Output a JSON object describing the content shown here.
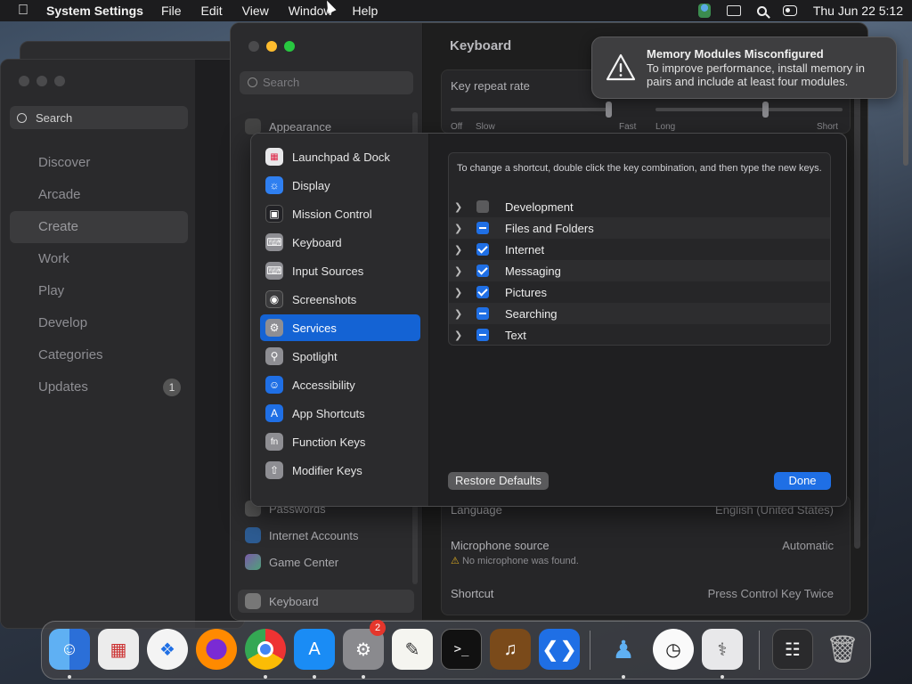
{
  "menubar": {
    "app_name": "System Settings",
    "items": [
      "File",
      "Edit",
      "View",
      "Window",
      "Help"
    ],
    "clock": "Thu Jun 22  5:12"
  },
  "appstore": {
    "search_placeholder": "Search",
    "nav": [
      {
        "label": "Discover"
      },
      {
        "label": "Arcade"
      },
      {
        "label": "Create",
        "active": true
      },
      {
        "label": "Work"
      },
      {
        "label": "Play"
      },
      {
        "label": "Develop"
      },
      {
        "label": "Categories"
      },
      {
        "label": "Updates",
        "badge": "1"
      }
    ]
  },
  "settings": {
    "search_placeholder": "Search",
    "title": "Keyboard",
    "sidebar": [
      "Appearance",
      "Passwords",
      "Internet Accounts",
      "Game Center",
      "Keyboard"
    ],
    "key_repeat_label": "Key repeat rate",
    "slider1_labels": [
      "Off",
      "Slow",
      "Fast"
    ],
    "slider2_labels": [
      "Long",
      "Short"
    ],
    "language_label": "Language",
    "language_value": "English (United States)",
    "mic_label": "Microphone source",
    "mic_value": "Automatic",
    "mic_warning": "No microphone was found.",
    "shortcut_label": "Shortcut",
    "shortcut_value": "Press Control Key Twice"
  },
  "notification": {
    "title": "Memory Modules Misconfigured",
    "body": "To improve performance, install memory in pairs and include at least four modules."
  },
  "sheet": {
    "categories": [
      {
        "label": "Launchpad & Dock",
        "icon": "launchpad-icon",
        "color": "#e8e8ea"
      },
      {
        "label": "Display",
        "icon": "display-icon",
        "color": "#2f7ff0"
      },
      {
        "label": "Mission Control",
        "icon": "mission-control-icon",
        "color": "#222226"
      },
      {
        "label": "Keyboard",
        "icon": "keyboard-icon",
        "color": "#8e8e93"
      },
      {
        "label": "Input Sources",
        "icon": "input-sources-icon",
        "color": "#8e8e93"
      },
      {
        "label": "Screenshots",
        "icon": "screenshots-icon",
        "color": "#3a3a3c"
      },
      {
        "label": "Services",
        "icon": "services-icon",
        "color": "#8e8e93",
        "selected": true
      },
      {
        "label": "Spotlight",
        "icon": "spotlight-icon",
        "color": "#8e8e93"
      },
      {
        "label": "Accessibility",
        "icon": "accessibility-icon",
        "color": "#1f6fe5"
      },
      {
        "label": "App Shortcuts",
        "icon": "app-shortcuts-icon",
        "color": "#1f6fe5"
      },
      {
        "label": "Function Keys",
        "icon": "function-keys-icon",
        "color": "#8e8e93"
      },
      {
        "label": "Modifier Keys",
        "icon": "modifier-keys-icon",
        "color": "#8e8e93"
      }
    ],
    "hint": "To change a shortcut, double click the key combination, and then type the new keys.",
    "services": [
      {
        "label": "Development",
        "state": "off"
      },
      {
        "label": "Files and Folders",
        "state": "mixed"
      },
      {
        "label": "Internet",
        "state": "on"
      },
      {
        "label": "Messaging",
        "state": "on"
      },
      {
        "label": "Pictures",
        "state": "on"
      },
      {
        "label": "Searching",
        "state": "mixed"
      },
      {
        "label": "Text",
        "state": "mixed"
      }
    ],
    "restore_label": "Restore Defaults",
    "done_label": "Done"
  },
  "dock": {
    "apps": [
      "Finder",
      "Launchpad",
      "Safari",
      "Firefox",
      "Chrome",
      "App Store",
      "System Settings",
      "TextEdit",
      "Terminal",
      "GarageBand",
      "VS Code",
      "Migration Assistant",
      "Clock",
      "Disk Utility",
      "Downloads",
      "Trash"
    ],
    "settings_badge": "2"
  },
  "colors": {
    "accent": "#1f6fe5",
    "selection": "#1463d4",
    "warning": "#f5c518"
  }
}
